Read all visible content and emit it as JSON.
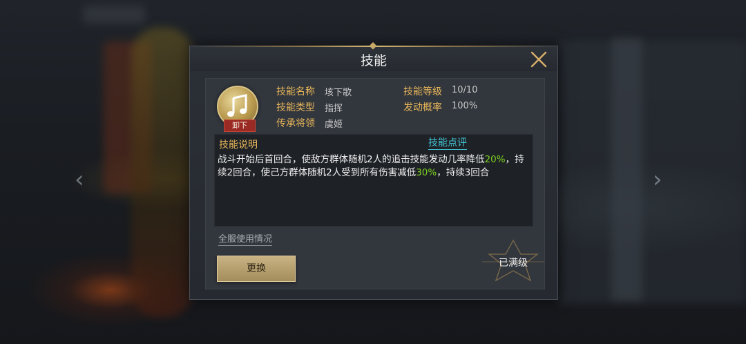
{
  "dialog": {
    "title": "技能",
    "close_icon": "close-icon"
  },
  "skill": {
    "icon": "music-note-icon",
    "unequip_label": "卸下",
    "name_label": "技能名称",
    "name_value": "垓下歌",
    "type_label": "技能类型",
    "type_value": "指挥",
    "inherit_label": "传承将领",
    "inherit_value": "虞姬",
    "level_label": "技能等级",
    "level_value": "10/10",
    "chance_label": "发动概率",
    "chance_value": "100%"
  },
  "description": {
    "title": "技能说明",
    "review_link": "技能点评",
    "part1": "战斗开始后首回合，使敌方群体随机2人的追击技能发动几率降低",
    "value1": "20%",
    "part2": "，持续2回合，使己方群体随机2人受到所有伤害减低",
    "value2": "30%",
    "part3": "，持续3回合"
  },
  "footer": {
    "usage_link": "全服使用情况",
    "replace_button": "更换",
    "maxed_label": "已满级"
  },
  "colors": {
    "gold_label": "#e8b75a",
    "highlight_green": "#7ed321",
    "link_cyan": "#43c6d6",
    "unequip_red": "#9a2a24"
  }
}
